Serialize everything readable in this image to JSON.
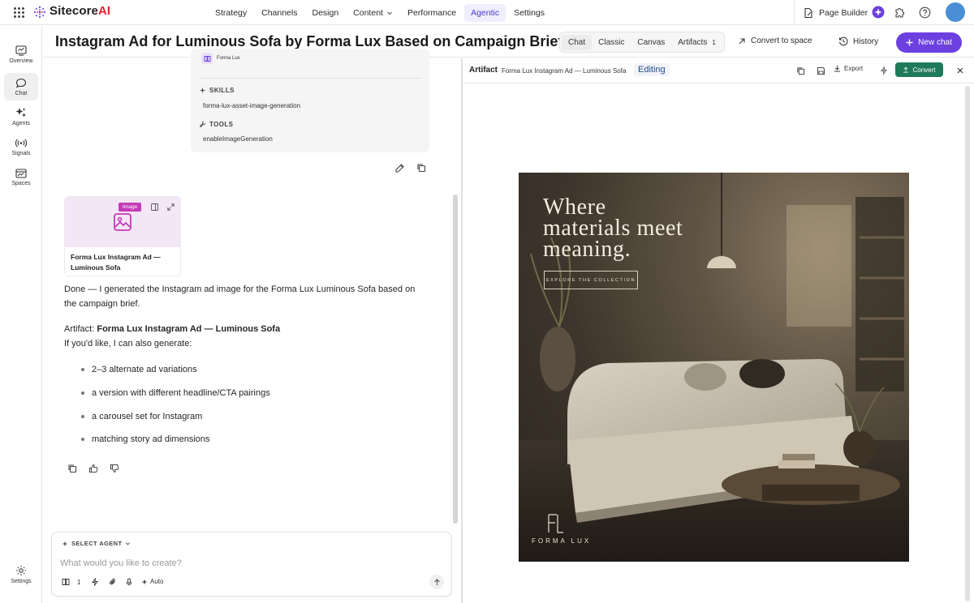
{
  "app": {
    "logo_text": "Sitecore",
    "logo_ai": "AI",
    "nav": [
      {
        "label": "Strategy"
      },
      {
        "label": "Channels"
      },
      {
        "label": "Design"
      },
      {
        "label": "Content"
      },
      {
        "label": "Performance"
      },
      {
        "label": "Agentic"
      },
      {
        "label": "Settings"
      }
    ],
    "active_nav": "Agentic",
    "page_builder_label": "Page Builder"
  },
  "rail": {
    "items": [
      {
        "label": "Overview",
        "icon": "overview-icon"
      },
      {
        "label": "Chat",
        "icon": "chat-icon"
      },
      {
        "label": "Agents",
        "icon": "agents-icon"
      },
      {
        "label": "Signals",
        "icon": "signals-icon"
      },
      {
        "label": "Spaces",
        "icon": "spaces-icon"
      }
    ],
    "settings_label": "Settings"
  },
  "titlebar": {
    "title": "Instagram Ad for Luminous Sofa by Forma Lux Based on Campaign Brief",
    "tabs": [
      {
        "label": "Chat"
      },
      {
        "label": "Classic"
      },
      {
        "label": "Canvas"
      },
      {
        "label": "Artifacts"
      }
    ],
    "artifacts_count": "1",
    "convert_to_space": "Convert to space",
    "history": "History",
    "new_chat": "New chat"
  },
  "agent_card": {
    "agent_name": "Forma Lux",
    "skills_heading": "SKILLS",
    "skill": "forma-lux-asset-image-generation",
    "tools_heading": "TOOLS",
    "tool": "enableImageGeneration"
  },
  "image_card": {
    "badge": "Image",
    "caption": "Forma Lux Instagram Ad — Luminous Sofa"
  },
  "message": {
    "done_text": "Done — I generated the Instagram ad image for the Forma Lux Luminous Sofa based on the campaign brief.",
    "artifact_prefix": "Artifact:",
    "artifact_name": "Forma Lux Instagram Ad — Luminous Sofa",
    "offer_text": "If you'd like, I can also generate:",
    "options": [
      "2–3 alternate ad variations",
      "a version with different headline/CTA pairings",
      "a carousel set for Instagram",
      "matching story ad dimensions"
    ]
  },
  "composer": {
    "select_agent": "SELECT AGENT",
    "placeholder": "What would you like to create?",
    "value": "",
    "context_count": "1",
    "mode": "Auto"
  },
  "artifact": {
    "label": "Artifact",
    "name": "Forma Lux Instagram Ad — Luminous Sofa",
    "status": "Editing",
    "export": "Export",
    "convert": "Convert"
  },
  "ad": {
    "headline": [
      "Where",
      "materials meet",
      "meaning."
    ],
    "cta": "EXPLORE THE COLLECTION",
    "brand": "FORMA LUX",
    "monogram": "FL"
  },
  "colors": {
    "accent": "#6b3fe0",
    "active_nav_text": "#4b3bd1",
    "convert_green": "#1f7a5a",
    "brand_red": "#e21f2e",
    "image_badge": "#c43bb8"
  }
}
